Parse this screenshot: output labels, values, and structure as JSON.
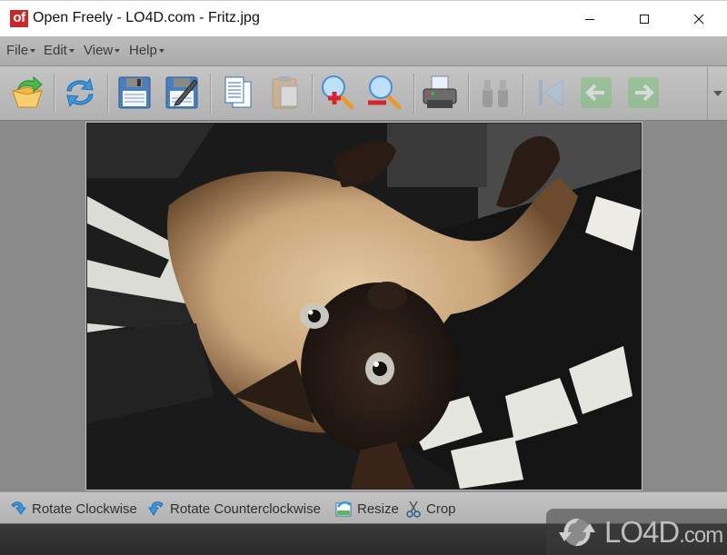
{
  "window": {
    "logo_text": "of",
    "title": "Open Freely - LO4D.com - Fritz.jpg",
    "controls": [
      "minimize",
      "maximize",
      "close"
    ]
  },
  "menu": {
    "items": [
      {
        "label": "File"
      },
      {
        "label": "Edit"
      },
      {
        "label": "View"
      },
      {
        "label": "Help"
      }
    ]
  },
  "toolbar": {
    "buttons": [
      {
        "name": "open",
        "icon": "open-folder-icon",
        "enabled": true
      },
      {
        "name": "refresh",
        "icon": "refresh-icon",
        "enabled": true
      },
      {
        "name": "save",
        "icon": "save-icon",
        "enabled": true
      },
      {
        "name": "save-as",
        "icon": "save-as-icon",
        "enabled": true
      },
      {
        "name": "copy",
        "icon": "copy-icon",
        "enabled": true
      },
      {
        "name": "paste",
        "icon": "paste-icon",
        "enabled": false
      },
      {
        "name": "zoom-in",
        "icon": "zoom-in-icon",
        "enabled": true
      },
      {
        "name": "zoom-out",
        "icon": "zoom-out-icon",
        "enabled": true
      },
      {
        "name": "print",
        "icon": "printer-icon",
        "enabled": true
      },
      {
        "name": "find",
        "icon": "binoculars-icon",
        "enabled": false
      },
      {
        "name": "first",
        "icon": "first-page-icon",
        "enabled": false
      },
      {
        "name": "back",
        "icon": "arrow-left-icon",
        "enabled": false
      },
      {
        "name": "forward",
        "icon": "arrow-right-icon",
        "enabled": false
      }
    ],
    "overflow_icon": "chevron-down-icon"
  },
  "viewer": {
    "image_description": "Siamese cat lying upside down on a black and white blanket"
  },
  "actions": {
    "items": [
      {
        "label": "Rotate Clockwise",
        "icon": "rotate-clockwise-icon"
      },
      {
        "label": "Rotate Counterclockwise",
        "icon": "rotate-counterclockwise-icon"
      },
      {
        "label": "Resize",
        "icon": "resize-icon"
      },
      {
        "label": "Crop",
        "icon": "scissors-icon"
      }
    ]
  },
  "watermark": {
    "text": "LO4D",
    "suffix": ".com"
  },
  "colors": {
    "brand_red": "#c8282a",
    "canvas_bg": "#8a8a8a",
    "toolbar_bg": "#bababa",
    "statusbar_bg": "#2f2f2f"
  }
}
